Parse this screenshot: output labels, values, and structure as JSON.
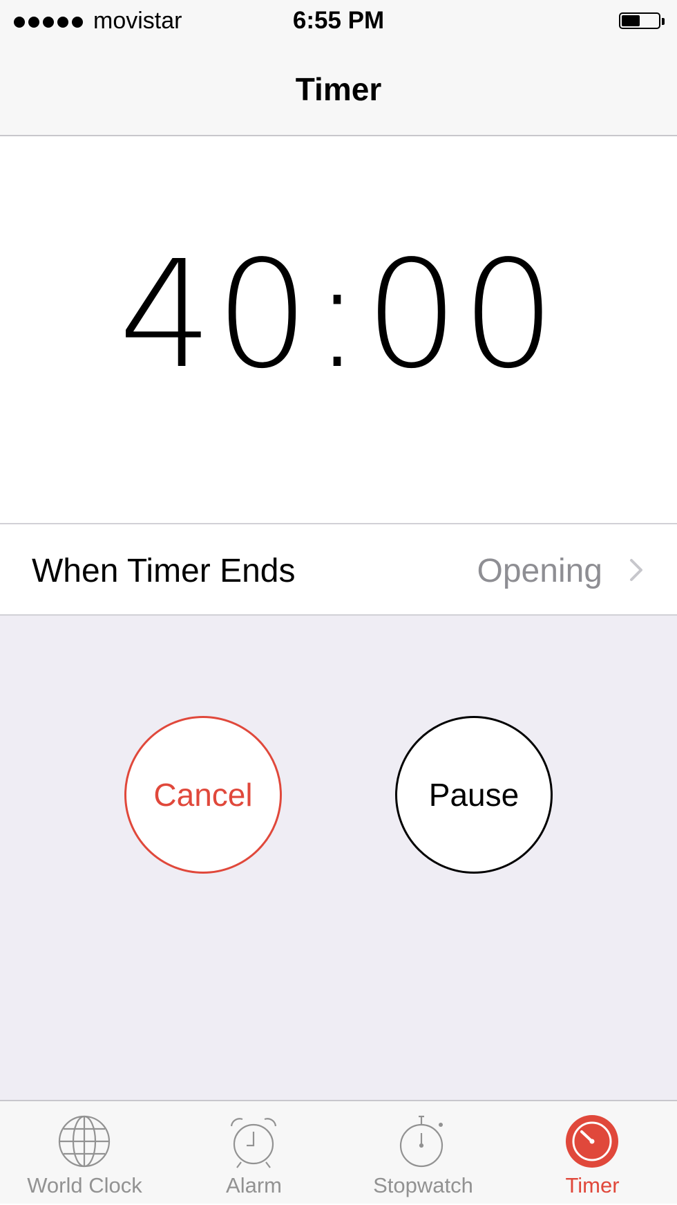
{
  "status_bar": {
    "carrier": "movistar",
    "time": "6:55 PM",
    "battery_level": 0.5
  },
  "nav": {
    "title": "Timer"
  },
  "timer": {
    "countdown": "40:00"
  },
  "when_timer_ends": {
    "label": "When Timer Ends",
    "value": "Opening"
  },
  "buttons": {
    "cancel": "Cancel",
    "pause": "Pause"
  },
  "tabs": [
    {
      "label": "World Clock",
      "icon": "globe-icon",
      "active": false
    },
    {
      "label": "Alarm",
      "icon": "alarm-clock-icon",
      "active": false
    },
    {
      "label": "Stopwatch",
      "icon": "stopwatch-icon",
      "active": false
    },
    {
      "label": "Timer",
      "icon": "timer-icon",
      "active": true
    }
  ],
  "colors": {
    "accent": "#e0483b",
    "inactive": "#929292",
    "secondary_text": "#8e8e93",
    "controls_background": "#efedf4"
  }
}
